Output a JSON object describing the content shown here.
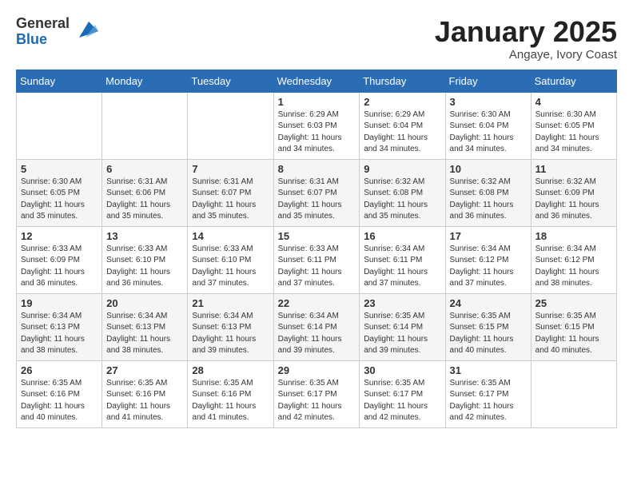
{
  "header": {
    "logo_line1": "General",
    "logo_line2": "Blue",
    "month": "January 2025",
    "location": "Angaye, Ivory Coast"
  },
  "weekdays": [
    "Sunday",
    "Monday",
    "Tuesday",
    "Wednesday",
    "Thursday",
    "Friday",
    "Saturday"
  ],
  "weeks": [
    [
      {
        "day": "",
        "info": ""
      },
      {
        "day": "",
        "info": ""
      },
      {
        "day": "",
        "info": ""
      },
      {
        "day": "1",
        "info": "Sunrise: 6:29 AM\nSunset: 6:03 PM\nDaylight: 11 hours\nand 34 minutes."
      },
      {
        "day": "2",
        "info": "Sunrise: 6:29 AM\nSunset: 6:04 PM\nDaylight: 11 hours\nand 34 minutes."
      },
      {
        "day": "3",
        "info": "Sunrise: 6:30 AM\nSunset: 6:04 PM\nDaylight: 11 hours\nand 34 minutes."
      },
      {
        "day": "4",
        "info": "Sunrise: 6:30 AM\nSunset: 6:05 PM\nDaylight: 11 hours\nand 34 minutes."
      }
    ],
    [
      {
        "day": "5",
        "info": "Sunrise: 6:30 AM\nSunset: 6:05 PM\nDaylight: 11 hours\nand 35 minutes."
      },
      {
        "day": "6",
        "info": "Sunrise: 6:31 AM\nSunset: 6:06 PM\nDaylight: 11 hours\nand 35 minutes."
      },
      {
        "day": "7",
        "info": "Sunrise: 6:31 AM\nSunset: 6:07 PM\nDaylight: 11 hours\nand 35 minutes."
      },
      {
        "day": "8",
        "info": "Sunrise: 6:31 AM\nSunset: 6:07 PM\nDaylight: 11 hours\nand 35 minutes."
      },
      {
        "day": "9",
        "info": "Sunrise: 6:32 AM\nSunset: 6:08 PM\nDaylight: 11 hours\nand 35 minutes."
      },
      {
        "day": "10",
        "info": "Sunrise: 6:32 AM\nSunset: 6:08 PM\nDaylight: 11 hours\nand 36 minutes."
      },
      {
        "day": "11",
        "info": "Sunrise: 6:32 AM\nSunset: 6:09 PM\nDaylight: 11 hours\nand 36 minutes."
      }
    ],
    [
      {
        "day": "12",
        "info": "Sunrise: 6:33 AM\nSunset: 6:09 PM\nDaylight: 11 hours\nand 36 minutes."
      },
      {
        "day": "13",
        "info": "Sunrise: 6:33 AM\nSunset: 6:10 PM\nDaylight: 11 hours\nand 36 minutes."
      },
      {
        "day": "14",
        "info": "Sunrise: 6:33 AM\nSunset: 6:10 PM\nDaylight: 11 hours\nand 37 minutes."
      },
      {
        "day": "15",
        "info": "Sunrise: 6:33 AM\nSunset: 6:11 PM\nDaylight: 11 hours\nand 37 minutes."
      },
      {
        "day": "16",
        "info": "Sunrise: 6:34 AM\nSunset: 6:11 PM\nDaylight: 11 hours\nand 37 minutes."
      },
      {
        "day": "17",
        "info": "Sunrise: 6:34 AM\nSunset: 6:12 PM\nDaylight: 11 hours\nand 37 minutes."
      },
      {
        "day": "18",
        "info": "Sunrise: 6:34 AM\nSunset: 6:12 PM\nDaylight: 11 hours\nand 38 minutes."
      }
    ],
    [
      {
        "day": "19",
        "info": "Sunrise: 6:34 AM\nSunset: 6:13 PM\nDaylight: 11 hours\nand 38 minutes."
      },
      {
        "day": "20",
        "info": "Sunrise: 6:34 AM\nSunset: 6:13 PM\nDaylight: 11 hours\nand 38 minutes."
      },
      {
        "day": "21",
        "info": "Sunrise: 6:34 AM\nSunset: 6:13 PM\nDaylight: 11 hours\nand 39 minutes."
      },
      {
        "day": "22",
        "info": "Sunrise: 6:34 AM\nSunset: 6:14 PM\nDaylight: 11 hours\nand 39 minutes."
      },
      {
        "day": "23",
        "info": "Sunrise: 6:35 AM\nSunset: 6:14 PM\nDaylight: 11 hours\nand 39 minutes."
      },
      {
        "day": "24",
        "info": "Sunrise: 6:35 AM\nSunset: 6:15 PM\nDaylight: 11 hours\nand 40 minutes."
      },
      {
        "day": "25",
        "info": "Sunrise: 6:35 AM\nSunset: 6:15 PM\nDaylight: 11 hours\nand 40 minutes."
      }
    ],
    [
      {
        "day": "26",
        "info": "Sunrise: 6:35 AM\nSunset: 6:16 PM\nDaylight: 11 hours\nand 40 minutes."
      },
      {
        "day": "27",
        "info": "Sunrise: 6:35 AM\nSunset: 6:16 PM\nDaylight: 11 hours\nand 41 minutes."
      },
      {
        "day": "28",
        "info": "Sunrise: 6:35 AM\nSunset: 6:16 PM\nDaylight: 11 hours\nand 41 minutes."
      },
      {
        "day": "29",
        "info": "Sunrise: 6:35 AM\nSunset: 6:17 PM\nDaylight: 11 hours\nand 42 minutes."
      },
      {
        "day": "30",
        "info": "Sunrise: 6:35 AM\nSunset: 6:17 PM\nDaylight: 11 hours\nand 42 minutes."
      },
      {
        "day": "31",
        "info": "Sunrise: 6:35 AM\nSunset: 6:17 PM\nDaylight: 11 hours\nand 42 minutes."
      },
      {
        "day": "",
        "info": ""
      }
    ]
  ]
}
